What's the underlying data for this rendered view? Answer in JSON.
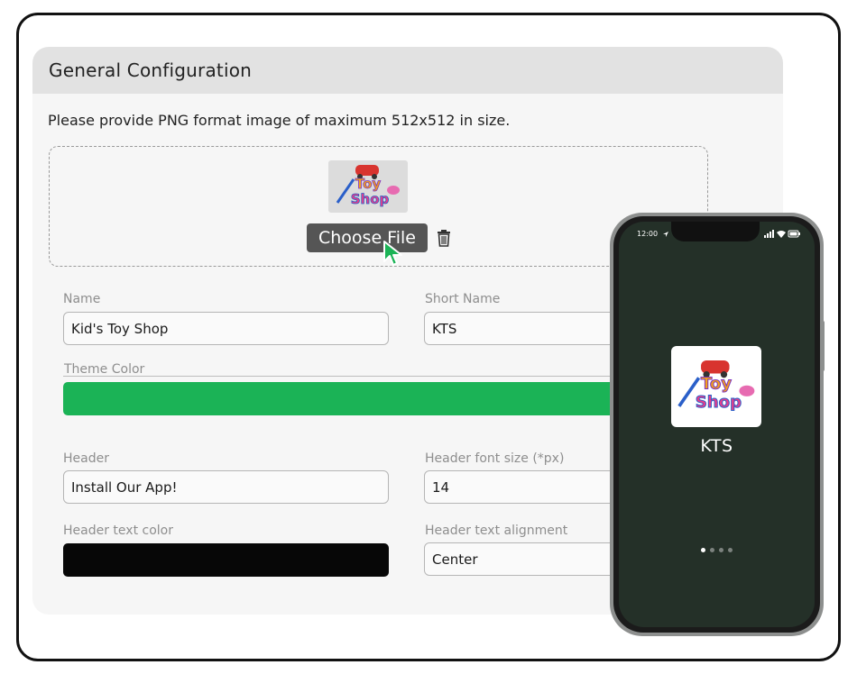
{
  "panel": {
    "title": "General Configuration",
    "instruction": "Please provide PNG format image of maximum 512x512 in size."
  },
  "upload": {
    "choose_file_label": "Choose File",
    "logo_text_top": "Toy",
    "logo_text_bottom": "Shop"
  },
  "form": {
    "name_label": "Name",
    "name_value": "Kid's Toy Shop",
    "short_name_label": "Short Name",
    "short_name_value": "KTS",
    "theme_color_label": "Theme Color",
    "theme_color": "#1bb356",
    "header_label": "Header",
    "header_value": "Install Our App!",
    "header_font_size_label": "Header font size (*px)",
    "header_font_size_value": "14",
    "header_text_color_label": "Header text color",
    "header_text_color": "#070707",
    "header_text_alignment_label": "Header text alignment",
    "header_text_alignment_value": "Center"
  },
  "phone": {
    "status_time": "12:00",
    "app_name": "KTS",
    "background_color": "#243028",
    "page_dots": 4,
    "active_dot": 1
  },
  "icons": [
    "trash-icon",
    "cursor-pointer-icon",
    "location-arrow-icon",
    "signal-icon",
    "wifi-icon",
    "battery-icon"
  ]
}
